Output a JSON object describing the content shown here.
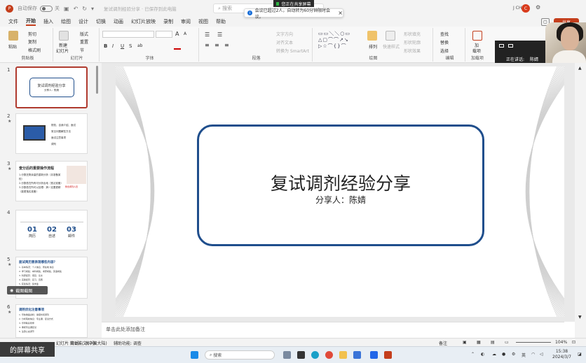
{
  "titlebar": {
    "logo": "P",
    "autosave_label": "自动保存",
    "autosave_state": "关",
    "doc_title": "复试调剂经验分享 · 已保存到此电脑",
    "search_placeholder": "搜索",
    "share_banner": "您正在共享屏幕",
    "meet_toast": "会议已超过2人，自动转为60分钟限时会议。",
    "user_initials": "J CH",
    "avatar_letter": "C"
  },
  "menu": {
    "items": [
      "文件",
      "开始",
      "插入",
      "绘图",
      "设计",
      "切换",
      "动画",
      "幻灯片放映",
      "录制",
      "审阅",
      "视图",
      "帮助"
    ],
    "active_index": 1,
    "share_label": "共享"
  },
  "ribbon": {
    "clipboard": {
      "label": "剪贴板",
      "paste": "粘贴",
      "cut": "剪切",
      "copy": "复制",
      "format_painter": "格式刷"
    },
    "slides": {
      "label": "幻灯片",
      "new_slide": "新建",
      "new_slide2": "幻灯片",
      "layout": "版式",
      "reset": "重置",
      "section": "节"
    },
    "font": {
      "label": "字体",
      "size_grow": "A",
      "size_shrink": "A",
      "bold": "B",
      "italic": "I",
      "underline": "U",
      "strike": "S",
      "spacing": "ab"
    },
    "paragraph": {
      "label": "段落",
      "text_direction": "文字方向",
      "align_text": "对齐文本",
      "smartart": "转换为 SmartArt"
    },
    "drawing": {
      "label": "绘图",
      "arrange": "排列",
      "quick_styles": "快速样式",
      "shape_fill": "形状填充",
      "shape_outline": "形状轮廓",
      "shape_effects": "形状效果"
    },
    "editing": {
      "label": "编辑",
      "find": "查找",
      "replace": "替换",
      "select": "选择"
    },
    "addins": {
      "label": "加载项",
      "addin": "加",
      "addin2": "载项"
    }
  },
  "meeting": {
    "speaking_label": "正在讲话:",
    "speaker": "陈婧",
    "name_tag": "陈婧",
    "share_caption": "的屏幕共享",
    "screenshot_caption": "截图截图"
  },
  "thumbnails": [
    {
      "num": "1",
      "title": "复试调剂经验分享",
      "sub": "分享人：陈婧"
    },
    {
      "num": "2",
      "items": [
        "院校、自我介绍、面试",
        "常见问题解答方法",
        "面试注意事项",
        "调剂"
      ]
    },
    {
      "num": "3",
      "title": "查分后的重要操作流程",
      "lines": [
        "1.分数还剩余量的重新分析（另准备某校）",
        "2.分数低在所有可分析出地（宽泛准备）",
        "3.分数低在所可以处理：搞一定要更精（能更落实准备）"
      ],
      "stamp": "整合调剂人员"
    },
    {
      "num": "4",
      "cols": [
        {
          "n": "01",
          "t": "简历"
        },
        {
          "n": "02",
          "t": "自述"
        },
        {
          "n": "03",
          "t": "邮件"
        }
      ]
    },
    {
      "num": "5",
      "title": "面试简历要表现哪些内容？",
      "lines": [
        "1. 基本情况：个人信息、所在地 信息",
        "2. 学习成绩：本科成绩、考研成绩、英语成绩",
        "3. 科研经历：项目、论文",
        "4. 实践经历：实习、竞赛",
        "5. 获奖情况：奖学金",
        "6. 自我评价：性格特点",
        "7. 其他：兴趣爱好"
      ]
    },
    {
      "num": "6",
      "title": "调剂优化注意事项",
      "lines": [
        "1. 尽快准备资料：争取时间调剂",
        "2. 分析院校信息：专业课、复试方式",
        "3. 尽早联系导师",
        "4. 重视专业课复试",
        "5. 注意心态调节"
      ]
    }
  ],
  "slide": {
    "title": "复试调剂经验分享",
    "subtitle": "分享人：陈婧"
  },
  "notes_placeholder": "单击此处添加备注",
  "status": {
    "slide_pos": "幻灯片 第1张，共7张",
    "language": "简体中文(中国大陆)",
    "accessibility": "辅助功能: 调查",
    "notes_label": "备注",
    "zoom": "104%"
  },
  "taskbar": {
    "search_placeholder": "搜索",
    "lang": "英",
    "time": "15:38",
    "date": "2024/3/7"
  },
  "colors": {
    "accent": "#c43e1c",
    "slide_border": "#1f4e8c",
    "speaking_green": "#2fb86a"
  }
}
